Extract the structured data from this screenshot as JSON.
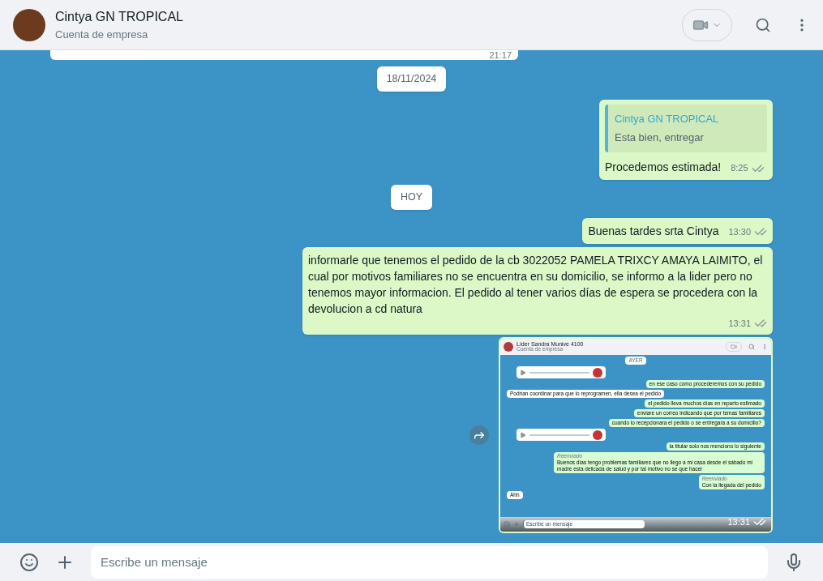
{
  "header": {
    "name": "Cintya GN TROPICAL",
    "subtitle": "Cuenta de empresa"
  },
  "messages": [
    {
      "kind": "cut",
      "time": "21:17"
    },
    {
      "kind": "date",
      "text": "18/11/2024"
    },
    {
      "kind": "out",
      "quote": {
        "author": "Cintya GN TROPICAL",
        "text": "Esta bien, entregar"
      },
      "text": "Procedemos estimada!",
      "time": "8:25",
      "read": false
    },
    {
      "kind": "date",
      "text": "HOY"
    },
    {
      "kind": "out",
      "text": "Buenas tardes srta Cintya",
      "time": "13:30",
      "read": false
    },
    {
      "kind": "out",
      "text": "informarle que tenemos el pedido de la cb 3022052 PAMELA TRIXCY AMAYA LAIMITO, el cual por motivos familiares no se encuentra en su domicilio, se informo a la lider pero no tenemos mayor informacion. El pedido al tener varios días de espera se procedera con la devolucion a cd natura",
      "time": "13:31",
      "read": false
    },
    {
      "kind": "image",
      "time": "13:31",
      "read": false,
      "screenshot": {
        "name": "Líder Sandra Munive 4100",
        "subtitle": "Cuenta de empresa",
        "placeholder": "Escribe un mensaje",
        "messages": [
          {
            "kind": "date",
            "text": "AYER"
          },
          {
            "kind": "audio"
          },
          {
            "kind": "out",
            "text": "en ese caso como procederemos con su pedido"
          },
          {
            "kind": "in",
            "text": "Podrian coordinar para que lo reprogramen, ella desea el pedido"
          },
          {
            "kind": "out",
            "text": "el pedido lleva muchos días en reparto estimado"
          },
          {
            "kind": "out",
            "text": "enviare un correo indicando que por temas familiares"
          },
          {
            "kind": "out",
            "text": "cuando lo recepcionara el pedido o se entregara a su domicilio?"
          },
          {
            "kind": "audio"
          },
          {
            "kind": "out",
            "text": "la titular solo nos menciono lo siguiente"
          },
          {
            "kind": "forwarded",
            "label": "Reenviado",
            "text": "Buenos días tengo problemas familiares que no llego a mi casa desde el sábado mi madre esta delicada de salud y por tal motivo no se que hacer"
          },
          {
            "kind": "forwarded",
            "label": "Reenviado",
            "text": "Con la llegada del pedido"
          },
          {
            "kind": "in",
            "text": "Ahh"
          }
        ]
      }
    }
  ],
  "composer": {
    "placeholder": "Escribe un mensaje"
  }
}
